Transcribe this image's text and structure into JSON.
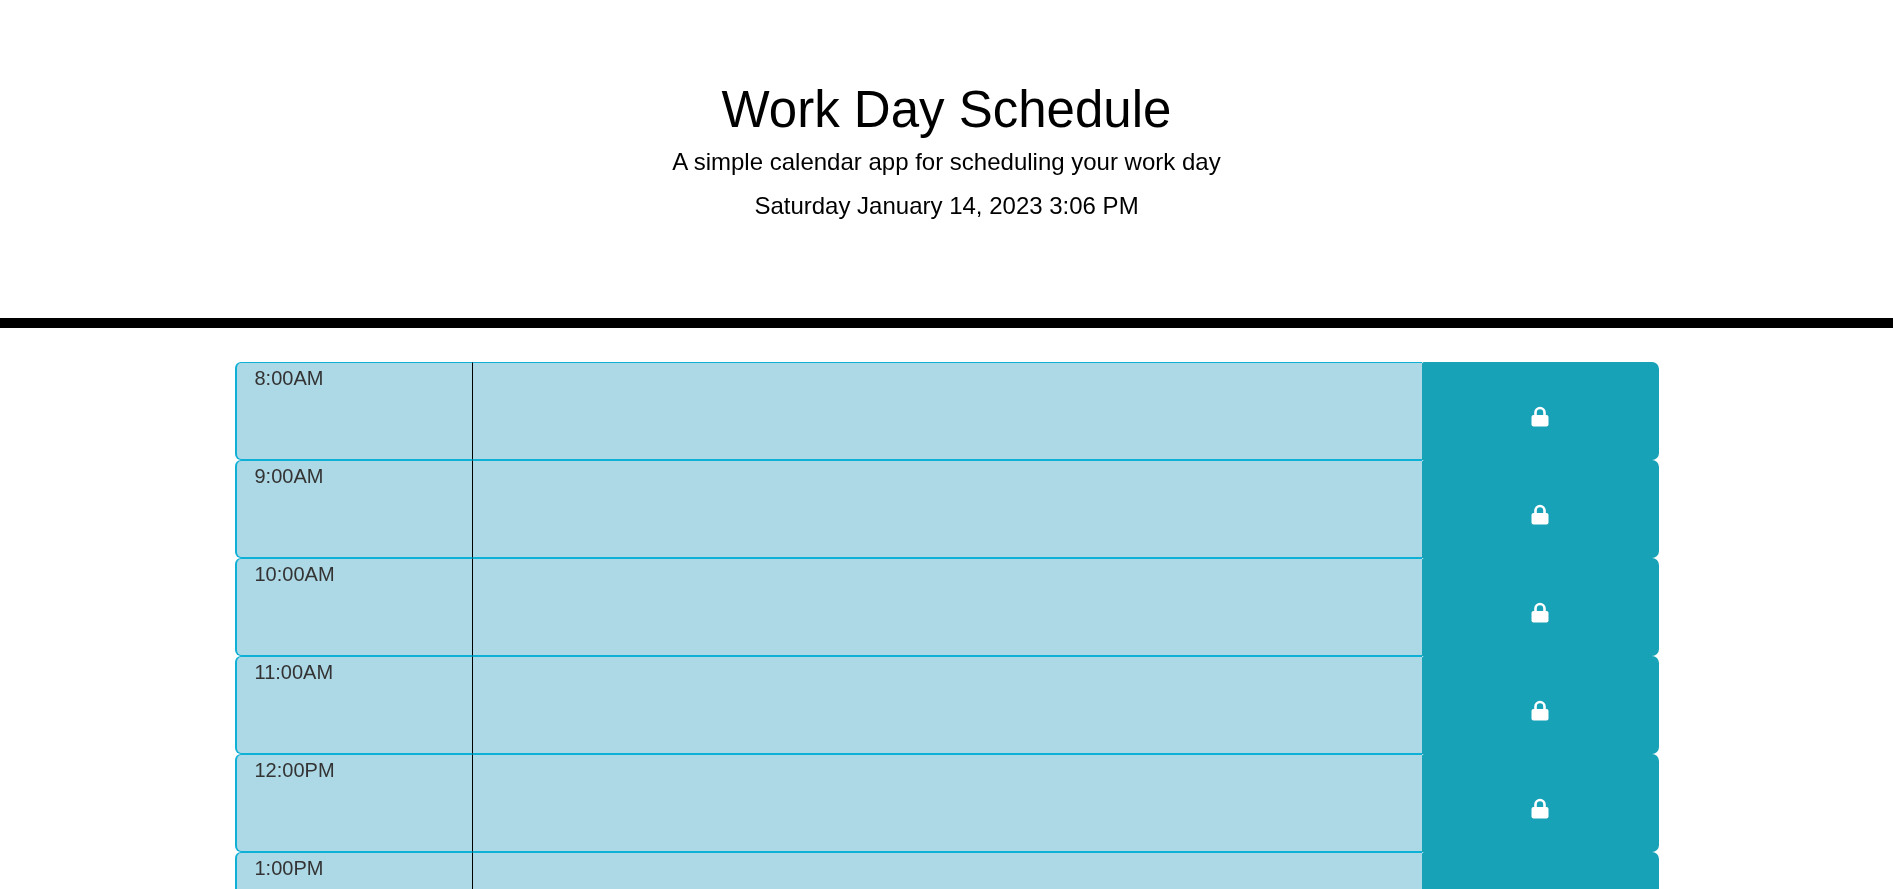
{
  "header": {
    "title": "Work Day Schedule",
    "subtitle": "A simple calendar app for scheduling your work day",
    "current_date": "Saturday January 14, 2023 3:06 PM"
  },
  "time_blocks": [
    {
      "hour": "8:00AM"
    },
    {
      "hour": "9:00AM"
    },
    {
      "hour": "10:00AM"
    },
    {
      "hour": "11:00AM"
    },
    {
      "hour": "12:00PM"
    },
    {
      "hour": "1:00PM"
    }
  ]
}
